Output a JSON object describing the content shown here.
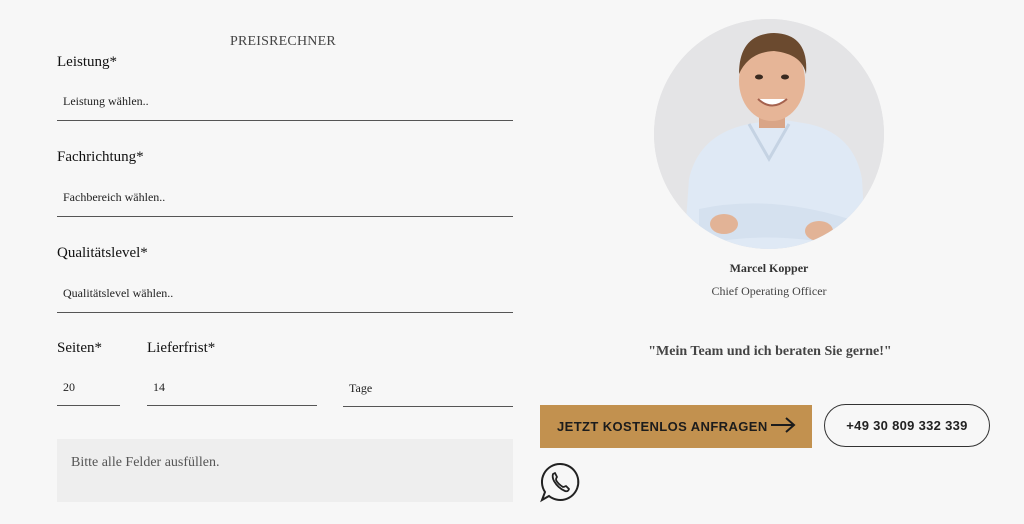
{
  "calculator": {
    "title": "PREISRECHNER",
    "service": {
      "label": "Leistung*",
      "placeholder": "Leistung wählen.."
    },
    "field": {
      "label": "Fachrichtung*",
      "placeholder": "Fachbereich wählen.."
    },
    "quality": {
      "label": "Qualitätslevel*",
      "placeholder": "Qualitätslevel wählen.."
    },
    "pages": {
      "label": "Seiten*",
      "value": "20"
    },
    "deadline": {
      "label": "Lieferfrist*",
      "value": "14",
      "unit": "Tage"
    },
    "message": "Bitte alle Felder ausfüllen."
  },
  "contact": {
    "name": "Marcel Kopper",
    "role": "Chief Operating Officer",
    "quote": "\"Mein Team und ich beraten Sie gerne!\"",
    "cta_label": "JETZT KOSTENLOS ANFRAGEN",
    "phone": "+49 30 809 332 339",
    "icons": {
      "cta": "arrow-right-icon",
      "messenger": "whatsapp-icon"
    }
  },
  "colors": {
    "accent": "#c2914f",
    "background": "#f7f7f7",
    "message_bg": "#eeeeee"
  }
}
